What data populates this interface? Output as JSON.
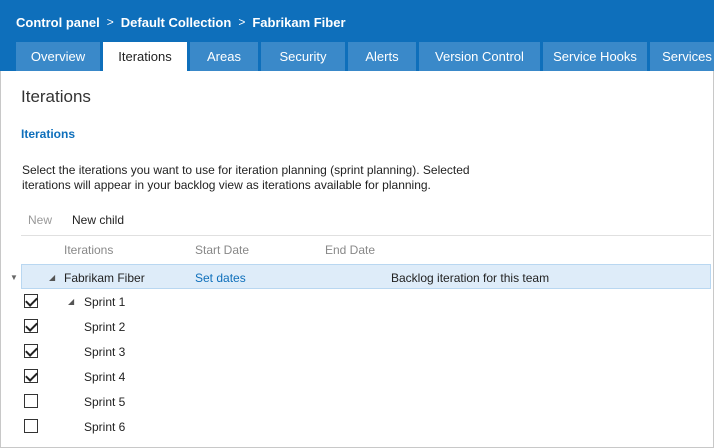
{
  "breadcrumb": [
    "Control panel",
    "Default Collection",
    "Fabrikam Fiber"
  ],
  "breadcrumb_separator": ">",
  "tabs": [
    {
      "label": "Overview",
      "active": false
    },
    {
      "label": "Iterations",
      "active": true
    },
    {
      "label": "Areas",
      "active": false
    },
    {
      "label": "Security",
      "active": false
    },
    {
      "label": "Alerts",
      "active": false
    },
    {
      "label": "Version Control",
      "active": false
    },
    {
      "label": "Service Hooks",
      "active": false
    },
    {
      "label": "Services",
      "active": false
    }
  ],
  "page_title": "Iterations",
  "section_title": "Iterations",
  "description": "Select the iterations you want to use for iteration planning (sprint planning). Selected iterations will appear in your backlog view as iterations available for planning.",
  "toolbar": {
    "new_label": "New",
    "new_child_label": "New child"
  },
  "columns": {
    "iterations": "Iterations",
    "start_date": "Start Date",
    "end_date": "End Date"
  },
  "root": {
    "name": "Fabrikam Fiber",
    "set_dates": "Set dates",
    "note": "Backlog iteration for this team"
  },
  "sprints": [
    {
      "name": "Sprint 1",
      "checked": true
    },
    {
      "name": "Sprint 2",
      "checked": true
    },
    {
      "name": "Sprint 3",
      "checked": true
    },
    {
      "name": "Sprint 4",
      "checked": true
    },
    {
      "name": "Sprint 5",
      "checked": false
    },
    {
      "name": "Sprint 6",
      "checked": false
    }
  ],
  "colors": {
    "accent": "#0e6fbb",
    "tab_inactive": "#3a89c9",
    "selected_row": "#deecf9"
  }
}
